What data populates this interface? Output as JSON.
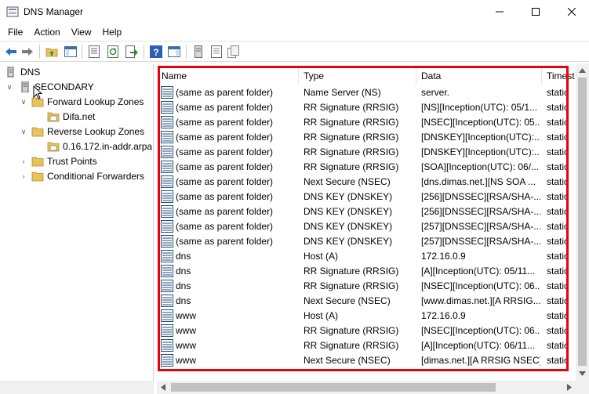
{
  "window": {
    "title": "DNS Manager"
  },
  "menu": [
    "File",
    "Action",
    "View",
    "Help"
  ],
  "toolbar": [
    "back-arrow-icon",
    "forward-arrow-icon",
    "up-folder-icon",
    "show-hide-tree-icon",
    "properties-icon",
    "refresh-icon",
    "export-list-icon",
    "help-icon",
    "show-hide-action-pane-icon",
    "server-icon",
    "server-list-icon",
    "copy-icon"
  ],
  "tree": {
    "root": "DNS",
    "server": "SECONDARY",
    "forward": "Forward Lookup Zones",
    "forward_zone": "Difa.net",
    "reverse": "Reverse Lookup Zones",
    "reverse_zone": "0.16.172.in-addr.arpa",
    "trust": "Trust Points",
    "conditional": "Conditional Forwarders"
  },
  "list": {
    "columns": [
      "Name",
      "Type",
      "Data",
      "Timest"
    ],
    "rows": [
      [
        "(same as parent folder)",
        "Name Server (NS)",
        "server.",
        "static"
      ],
      [
        "(same as parent folder)",
        "RR Signature (RRSIG)",
        "[NS][Inception(UTC): 05/1...",
        "static"
      ],
      [
        "(same as parent folder)",
        "RR Signature (RRSIG)",
        "[NSEC][Inception(UTC): 05...",
        "static"
      ],
      [
        "(same as parent folder)",
        "RR Signature (RRSIG)",
        "[DNSKEY][Inception(UTC):...",
        "static"
      ],
      [
        "(same as parent folder)",
        "RR Signature (RRSIG)",
        "[DNSKEY][Inception(UTC):...",
        "static"
      ],
      [
        "(same as parent folder)",
        "RR Signature (RRSIG)",
        "[SOA][Inception(UTC): 06/...",
        "static"
      ],
      [
        "(same as parent folder)",
        "Next Secure (NSEC)",
        "[dns.dimas.net.][NS SOA ...",
        "static"
      ],
      [
        "(same as parent folder)",
        "DNS KEY (DNSKEY)",
        "[256][DNSSEC][RSA/SHA-...",
        "static"
      ],
      [
        "(same as parent folder)",
        "DNS KEY (DNSKEY)",
        "[256][DNSSEC][RSA/SHA-...",
        "static"
      ],
      [
        "(same as parent folder)",
        "DNS KEY (DNSKEY)",
        "[257][DNSSEC][RSA/SHA-...",
        "static"
      ],
      [
        "(same as parent folder)",
        "DNS KEY (DNSKEY)",
        "[257][DNSSEC][RSA/SHA-...",
        "static"
      ],
      [
        "dns",
        "Host (A)",
        "172.16.0.9",
        "static"
      ],
      [
        "dns",
        "RR Signature (RRSIG)",
        "[A][Inception(UTC): 05/11...",
        "static"
      ],
      [
        "dns",
        "RR Signature (RRSIG)",
        "[NSEC][Inception(UTC): 06...",
        "static"
      ],
      [
        "dns",
        "Next Secure (NSEC)",
        "[www.dimas.net.][A RRSIG...",
        "static"
      ],
      [
        "www",
        "Host (A)",
        "172.16.0.9",
        "static"
      ],
      [
        "www",
        "RR Signature (RRSIG)",
        "[NSEC][Inception(UTC): 06...",
        "static"
      ],
      [
        "www",
        "RR Signature (RRSIG)",
        "[A][Inception(UTC): 06/11...",
        "static"
      ],
      [
        "www",
        "Next Secure (NSEC)",
        "[dimas.net.][A RRSIG NSEC]",
        "static"
      ]
    ]
  },
  "colors": {
    "highlight_border": "#e8000b",
    "folder": "#e8c25a",
    "record_icon": "#1f4e79"
  }
}
